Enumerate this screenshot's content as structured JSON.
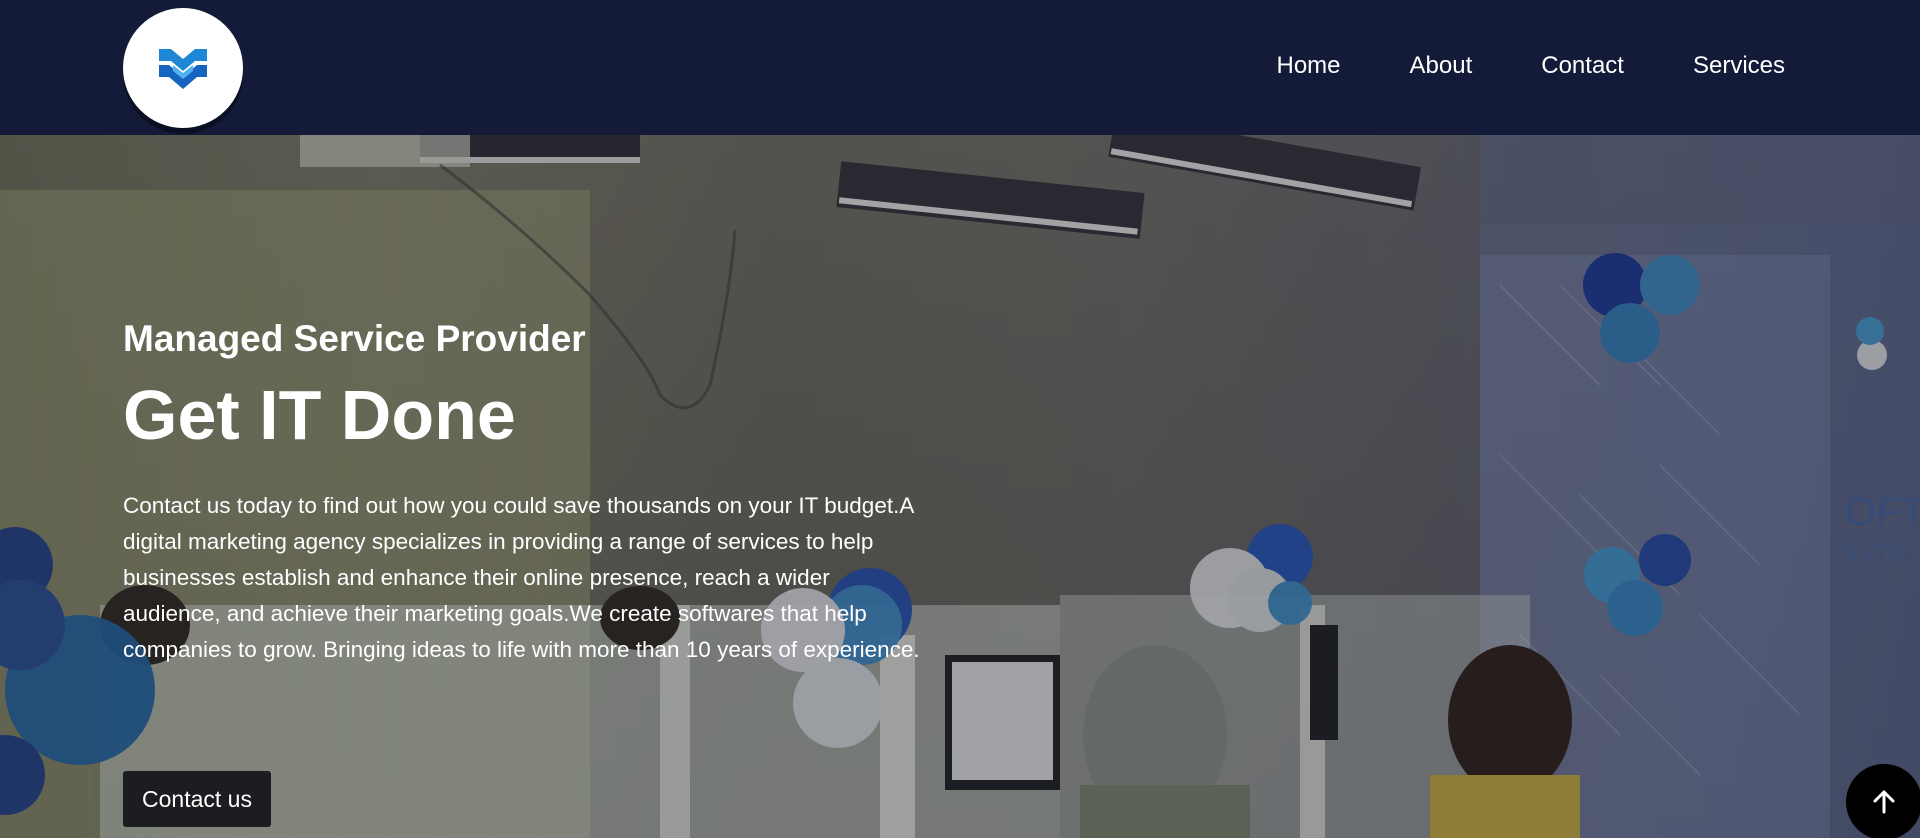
{
  "nav": {
    "items": [
      {
        "label": "Home"
      },
      {
        "label": "About"
      },
      {
        "label": "Contact"
      },
      {
        "label": "Services"
      }
    ]
  },
  "hero": {
    "subtitle": "Managed Service Provider",
    "title": "Get IT Done",
    "description": "Contact us today to find out how you could save thousands on your IT budget.A digital marketing agency specializes in providing a range of services to help businesses establish and enhance their online presence, reach a wider audience, and achieve their marketing goals.We create softwares that help companies to grow. Bringing ideas to life with more than 10 years of experience.",
    "cta_label": "Contact us"
  },
  "colors": {
    "navbar_bg": "#131b38",
    "logo_blue": "#1e88d6",
    "button_bg": "#1c1d20"
  },
  "icons": {
    "logo": "company-logo-mark",
    "back_to_top": "arrow-up-icon"
  }
}
